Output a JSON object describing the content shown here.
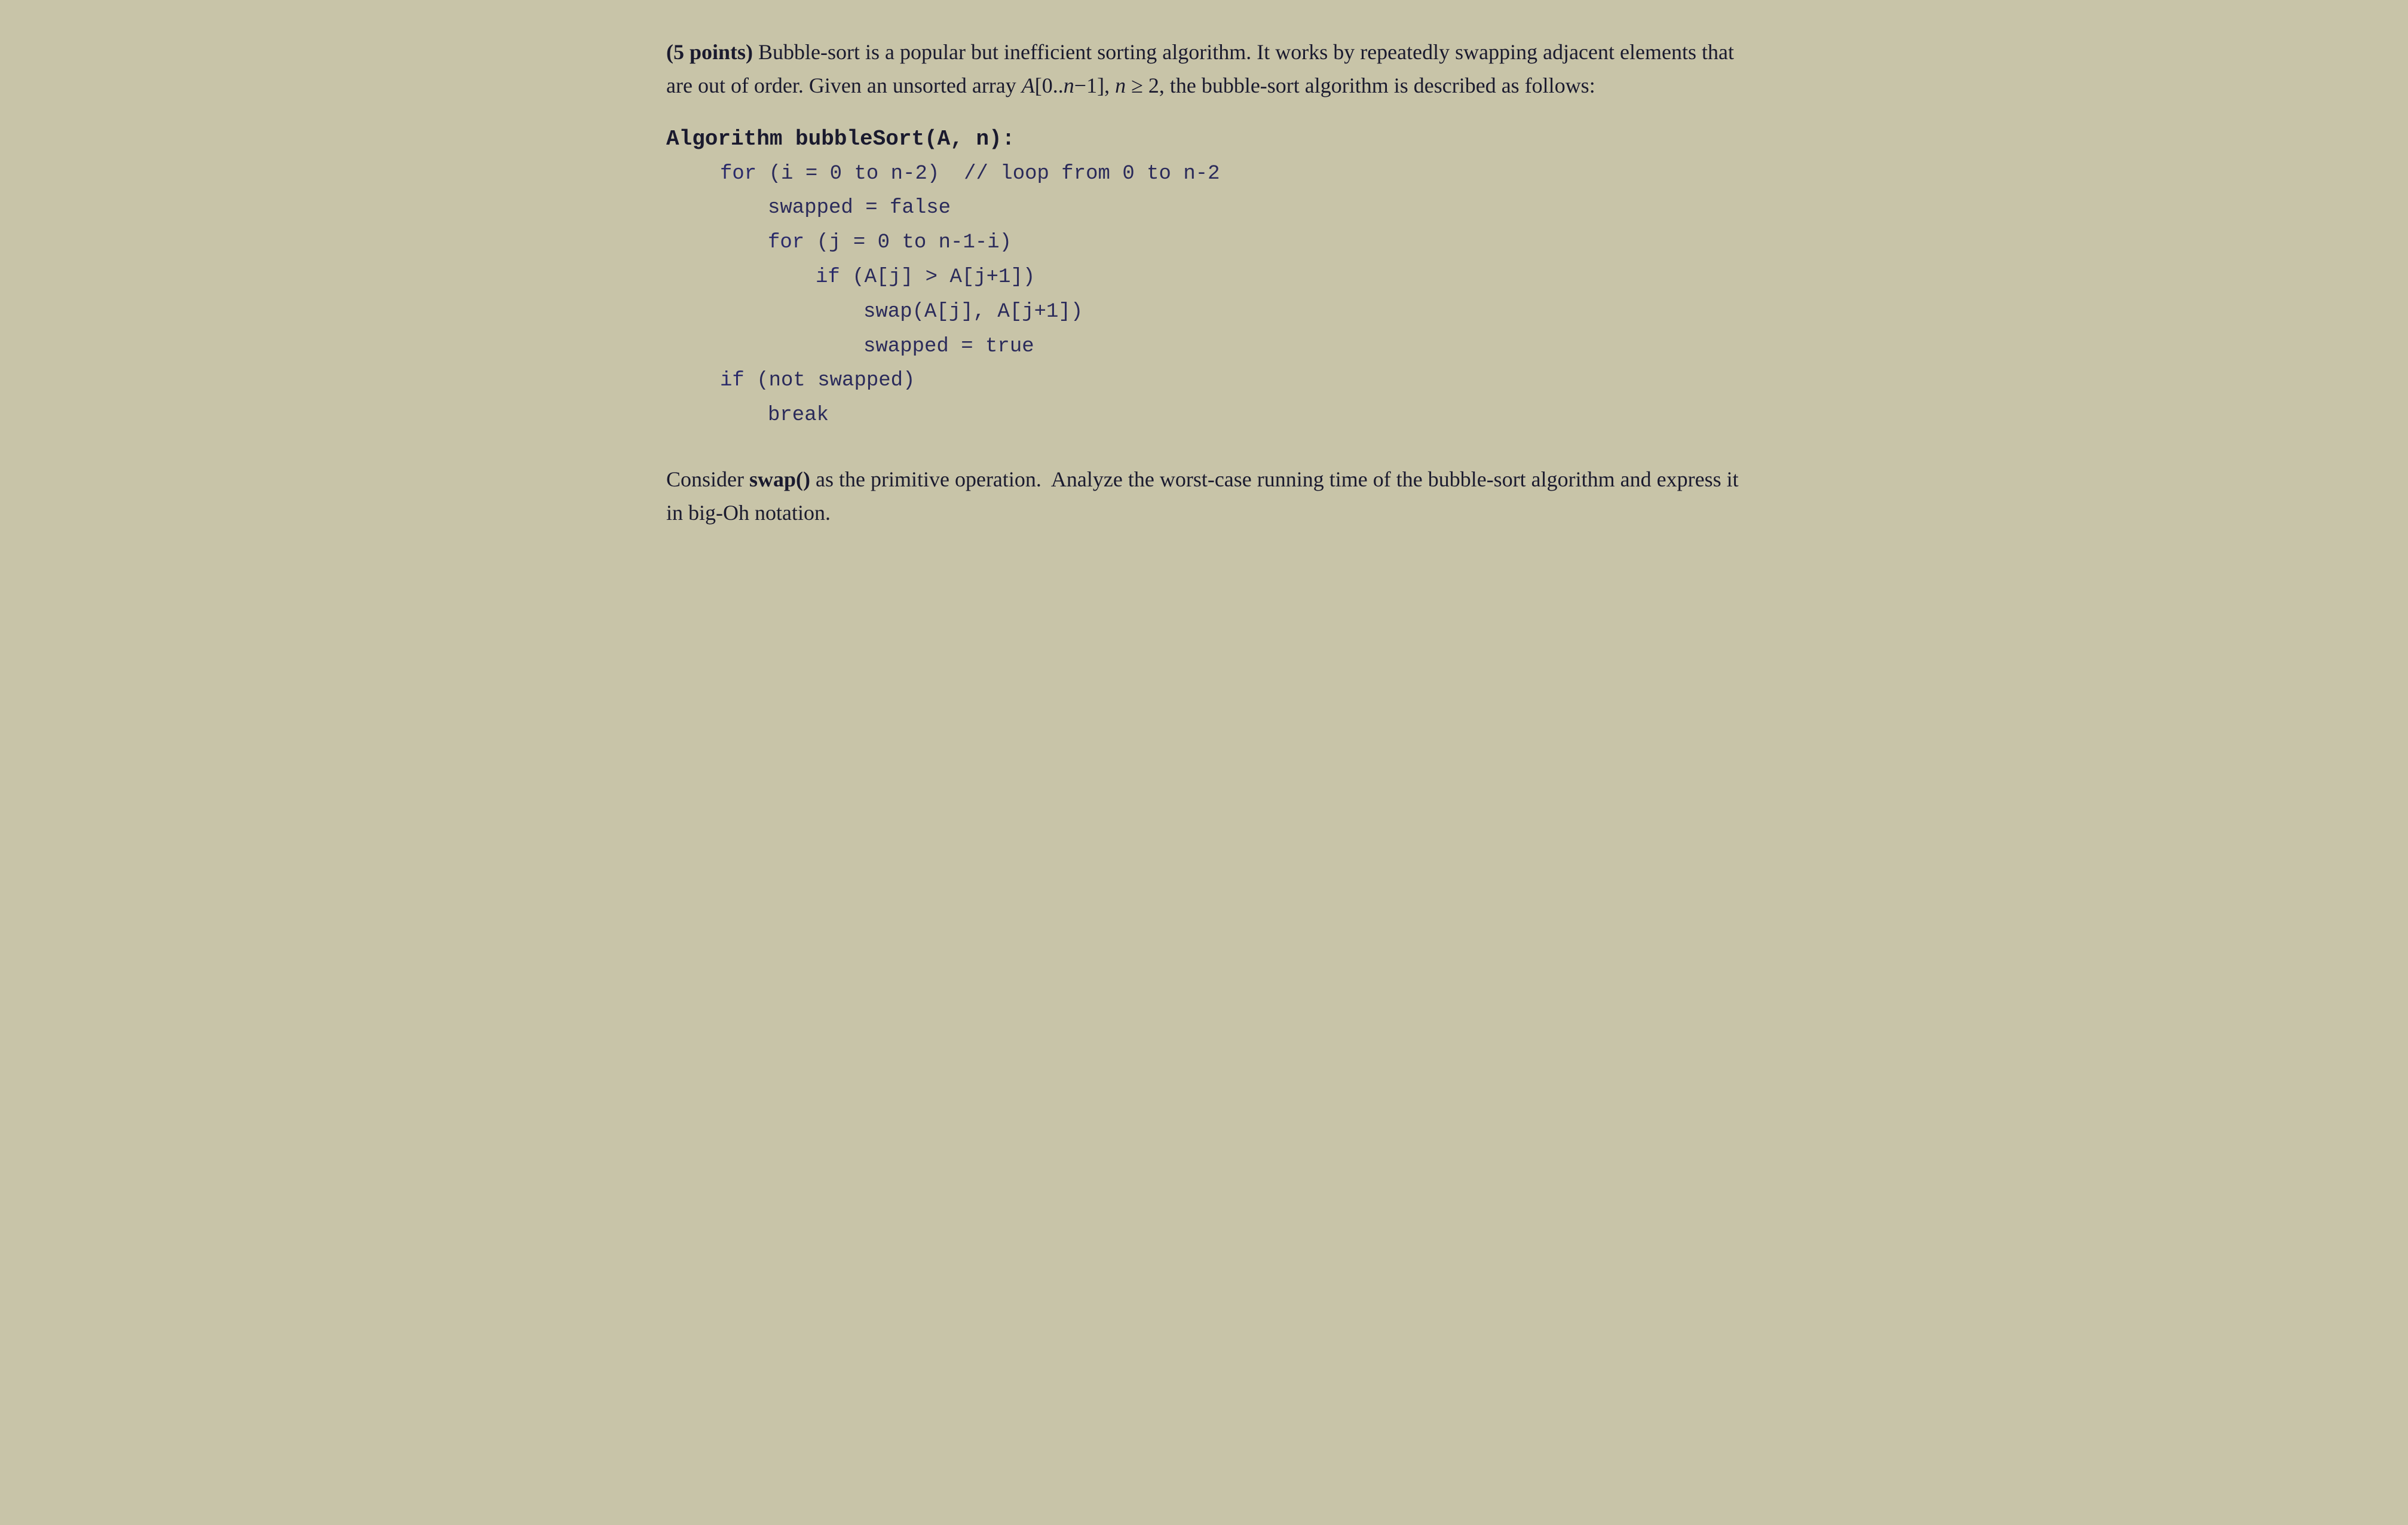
{
  "page": {
    "intro": {
      "points_label": "(5 points)",
      "description": "Bubble-sort is a popular but inefficient sorting algorithm. It works by repeatedly swapping adjacent elements that are out of order. Given an unsorted array A[0..n−1], n ≥ 2, the bubble-sort algorithm is described as follows:"
    },
    "algorithm": {
      "header": "Algorithm bubbleSort(A, n):",
      "lines": [
        {
          "indent": 1,
          "text": "for (i = 0 to n-2)  // loop from 0 to n-2"
        },
        {
          "indent": 2,
          "text": "swapped = false"
        },
        {
          "indent": 2,
          "text": "for (j = 0 to n-1-i)"
        },
        {
          "indent": 3,
          "text": "if (A[j] > A[j+1])"
        },
        {
          "indent": 4,
          "text": "swap(A[j], A[j+1])"
        },
        {
          "indent": 4,
          "text": "swapped = true"
        },
        {
          "indent": 1,
          "text": "if (not swapped)"
        },
        {
          "indent": 2,
          "text": "break"
        }
      ]
    },
    "conclusion": {
      "text": "Consider swap() as the primitive operation.  Analyze the worst-case running time of the bubble-sort algorithm and express it in big-Oh notation."
    }
  }
}
